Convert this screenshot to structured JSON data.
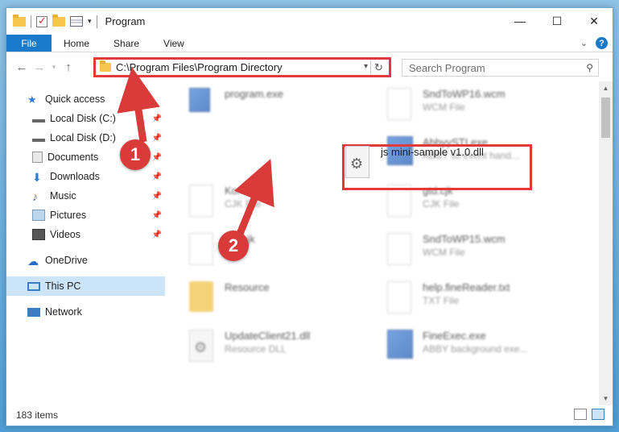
{
  "window": {
    "title": "Program",
    "controls": {
      "minimize": "—",
      "maximize": "☐",
      "close": "✕"
    }
  },
  "ribbon": {
    "tabs": [
      "File",
      "Home",
      "Share",
      "View"
    ]
  },
  "address": {
    "path": "C:\\Program Files\\Program Directory",
    "search_placeholder": "Search Program"
  },
  "sidebar": {
    "quick_access": "Quick access",
    "items": [
      {
        "label": "Local Disk (C:)",
        "icon": "drive-icon"
      },
      {
        "label": "Local Disk (D:)",
        "icon": "drive-icon"
      },
      {
        "label": "Documents",
        "icon": "documents-icon"
      },
      {
        "label": "Downloads",
        "icon": "downloads-icon"
      },
      {
        "label": "Music",
        "icon": "music-icon"
      },
      {
        "label": "Pictures",
        "icon": "pictures-icon"
      },
      {
        "label": "Videos",
        "icon": "videos-icon"
      }
    ],
    "onedrive": "OneDrive",
    "this_pc": "This PC",
    "network": "Network"
  },
  "files": {
    "highlighted": {
      "name": "js mini-sample v1.0.dll"
    },
    "items": [
      {
        "name": "program.exe",
        "type": ""
      },
      {
        "name": "SndToWP16.wcm",
        "type": "WCM File"
      },
      {
        "name": "AbbyySTI.exe",
        "type": "ABBY sti event hand..."
      },
      {
        "name": "Kor...cjk",
        "type": "CJK File"
      },
      {
        "name": "gtd.cjk",
        "type": "CJK File"
      },
      {
        "name": "...n.cjk",
        "type": "...le"
      },
      {
        "name": "SndToWP15.wcm",
        "type": "WCM File"
      },
      {
        "name": "Resource",
        "type": ""
      },
      {
        "name": "help.fineReader.txt",
        "type": "TXT File"
      },
      {
        "name": "UpdateClient21.dll",
        "type": "Resource DLL"
      },
      {
        "name": "FineExec.exe",
        "type": "ABBY background exe..."
      }
    ]
  },
  "status": {
    "item_count": "183 items"
  },
  "annotations": {
    "step1": "1",
    "step2": "2"
  },
  "colors": {
    "accent": "#1979ca",
    "highlight": "#e23a3a"
  }
}
